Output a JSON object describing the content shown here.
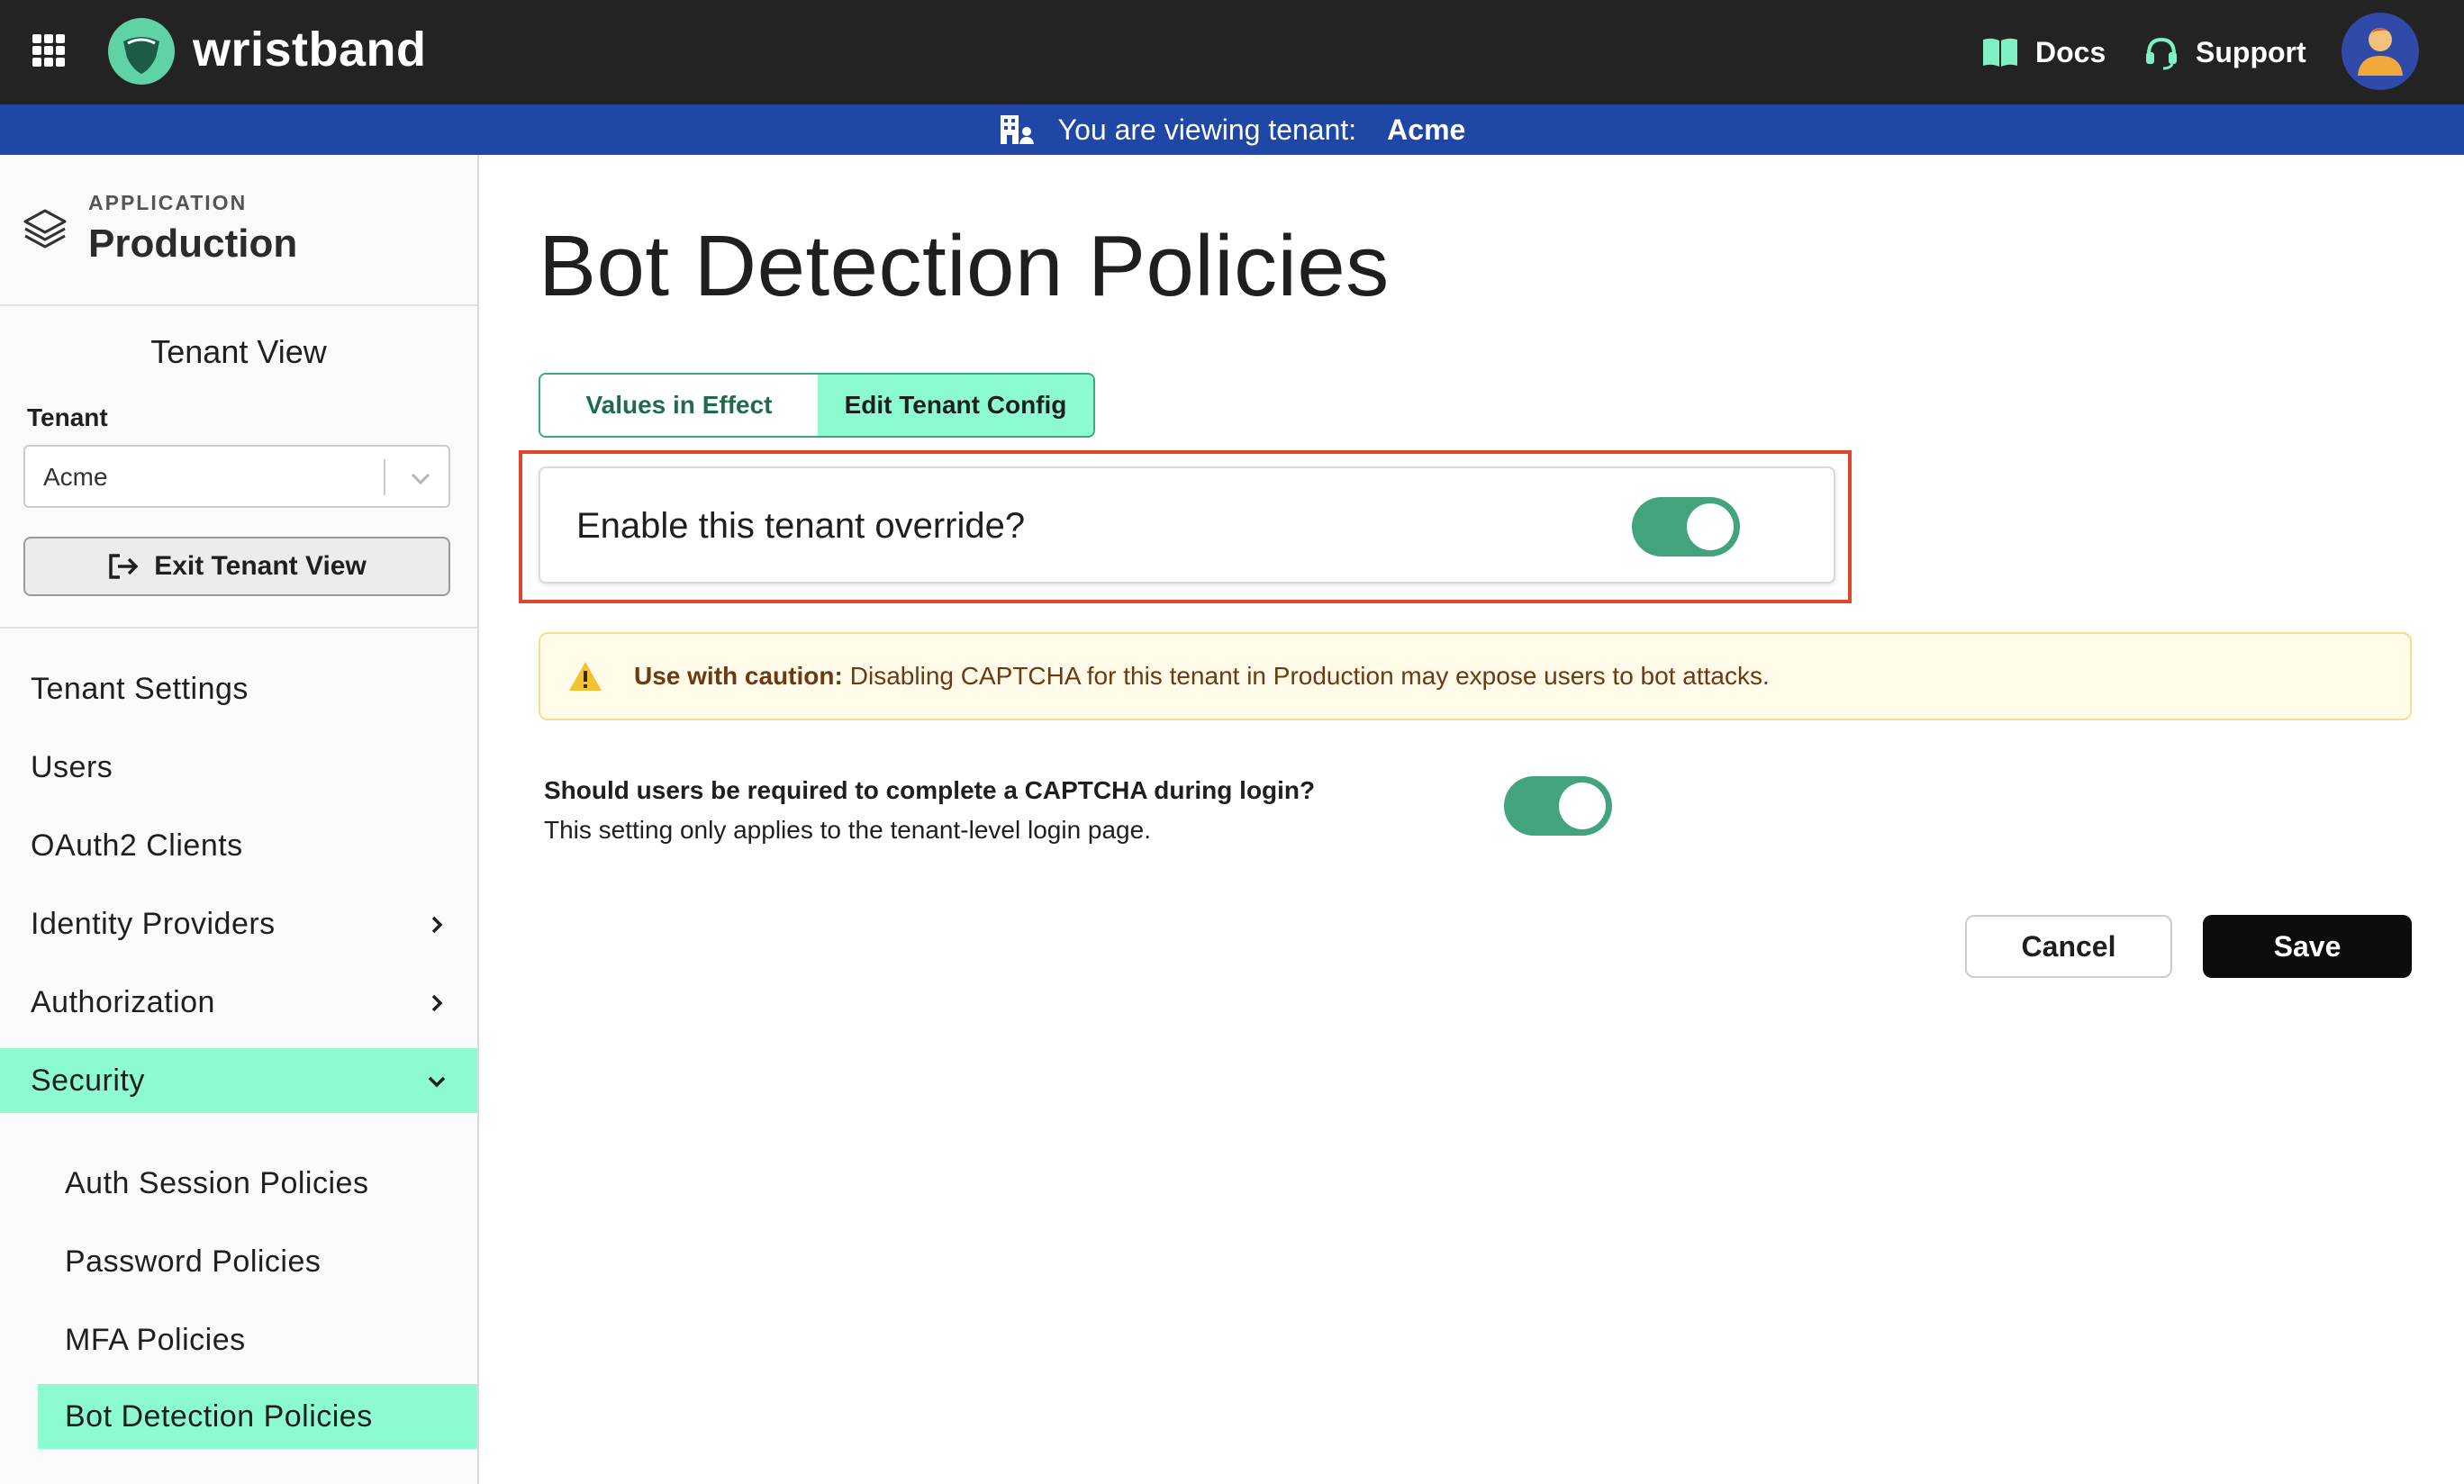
{
  "topbar": {
    "brand": "wristband",
    "docs_label": "Docs",
    "support_label": "Support",
    "icons": {
      "apps": "grid-icon",
      "logo": "shield-logo-icon",
      "docs": "book-icon",
      "support": "headset-icon",
      "avatar": "user-avatar"
    }
  },
  "banner": {
    "prefix": "You are viewing tenant:",
    "tenant": "Acme"
  },
  "sidebar": {
    "app_caption": "APPLICATION",
    "app_name": "Production",
    "tenant_view_title": "Tenant View",
    "tenant_label": "Tenant",
    "tenant_selected": "Acme",
    "exit_label": "Exit Tenant View",
    "nav": [
      {
        "label": "Tenant Settings"
      },
      {
        "label": "Users"
      },
      {
        "label": "OAuth2 Clients"
      },
      {
        "label": "Identity Providers"
      },
      {
        "label": "Authorization"
      },
      {
        "label": "Security"
      }
    ],
    "security_sub": [
      {
        "label": "Auth Session Policies"
      },
      {
        "label": "Password Policies"
      },
      {
        "label": "MFA Policies"
      },
      {
        "label": "Bot Detection Policies"
      }
    ]
  },
  "main": {
    "title": "Bot Detection Policies",
    "tabs": [
      {
        "label": "Values in Effect"
      },
      {
        "label": "Edit Tenant Config"
      }
    ],
    "override_label": "Enable this tenant override?",
    "warning_bold": "Use with caution:",
    "warning_text": "Disabling CAPTCHA for this tenant in Production may expose users to bot attacks.",
    "captcha_question": "Should users be required to complete a CAPTCHA during login?",
    "captcha_help": "This setting only applies to the tenant-level login page.",
    "cancel_label": "Cancel",
    "save_label": "Save"
  },
  "colors": {
    "topbar": "#232323",
    "banner": "#1e47a6",
    "accent_mint": "#8cfbcf",
    "toggle_on": "#43a37d",
    "highlight": "#e0452f"
  }
}
